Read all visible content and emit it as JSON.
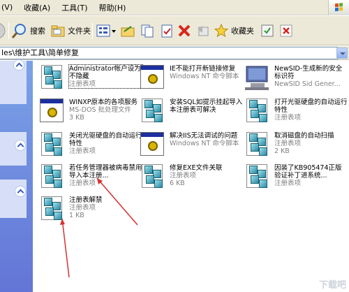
{
  "menu": [
    "(V)",
    "收藏(A)",
    "工具(T)",
    "帮助(H)"
  ],
  "toolbar": {
    "search_label": "搜索",
    "folders_label": "文件夹",
    "favorites_label": "收藏夹"
  },
  "address": {
    "path": "les\\维护工具\\简单修复"
  },
  "files": [
    {
      "name": "Administrator帐户设为不隐藏",
      "type": "注册表项",
      "size": ""
    },
    {
      "name": "IE不能打开新链接修复",
      "type": "Windows NT 命令脚本",
      "size": ""
    },
    {
      "name": "NewSID-生成新的安全标识符",
      "type": "NewSID Sid Gener...",
      "size": ""
    },
    {
      "name": "WINXP原本的各项服务",
      "type": "MS-DOS 批处理文件",
      "size": "3 KB"
    },
    {
      "name": "安装SQL如提示挂起导入本注册表可解决",
      "type": "",
      "size": ""
    },
    {
      "name": "打开光驱硬盘的自动运行特性",
      "type": "注册表项",
      "size": ""
    },
    {
      "name": "关闭光驱硬盘的自动运行特性",
      "type": "注册表项",
      "size": ""
    },
    {
      "name": "解决IIS无法调试的问题",
      "type": "Windows NT 命令脚本",
      "size": ""
    },
    {
      "name": "取消磁盘的自动扫描",
      "type": "注册表项",
      "size": "2 KB"
    },
    {
      "name": "若任务管理器被病毒禁用导入本注册...",
      "type": "注册表项",
      "size": ""
    },
    {
      "name": "修复EXE文件关联",
      "type": "注册表项",
      "size": "6 KB"
    },
    {
      "name": "因装了KB905474正版验证补丁进系统...",
      "type": "注册表项",
      "size": ""
    },
    {
      "name": "注册表解禁",
      "type": "注册表项",
      "size": "1 KB"
    }
  ],
  "watermark": "下载吧"
}
